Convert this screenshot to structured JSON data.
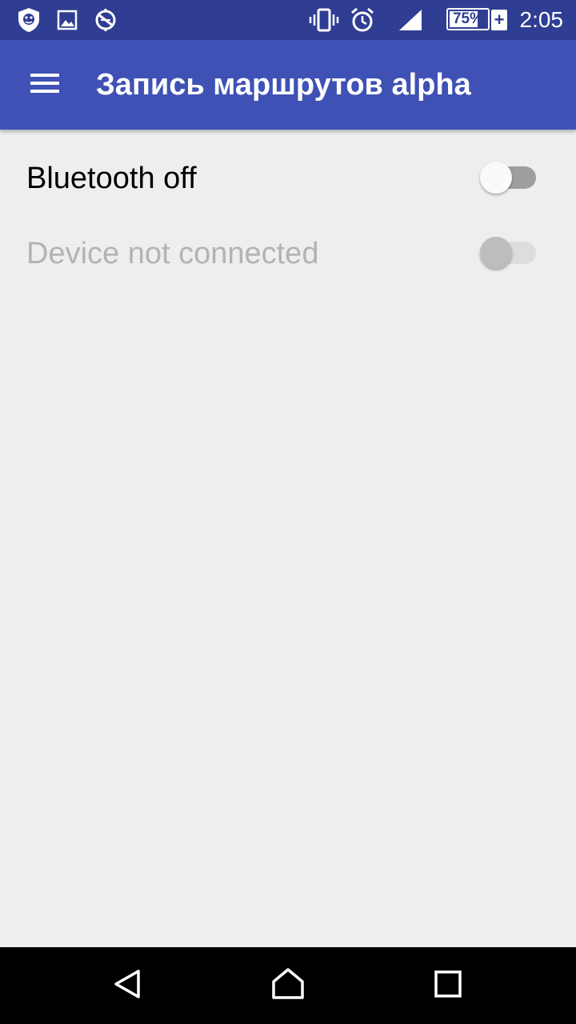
{
  "status_bar": {
    "time": "2:05",
    "battery_percent": "75%",
    "battery_level": 0.75,
    "icons": [
      "shield-notification-icon",
      "image-notification-icon",
      "no-sync-icon",
      "vibrate-icon",
      "alarm-icon",
      "signal-icon",
      "battery-icon",
      "charging-plus-icon"
    ]
  },
  "app_bar": {
    "title": "Запись маршрутов alpha",
    "menu_icon": "hamburger-menu-icon"
  },
  "settings": {
    "bluetooth": {
      "label": "Bluetooth off",
      "enabled": true,
      "checked": false
    },
    "device": {
      "label": "Device not connected",
      "enabled": false,
      "checked": false
    }
  },
  "nav_bar": {
    "icons": [
      "back-icon",
      "home-icon",
      "recents-icon"
    ]
  },
  "colors": {
    "status_bar": "#2f3e92",
    "app_bar": "#3f51b5",
    "background": "#eeeeee",
    "text_primary": "#000000",
    "text_disabled": "#b3b3b3",
    "switch_track_off": "#9e9e9e",
    "switch_thumb_off": "#fafafa",
    "switch_track_disabled": "#dddddd",
    "switch_thumb_disabled": "#bdbdbd",
    "nav_bar": "#000000"
  }
}
